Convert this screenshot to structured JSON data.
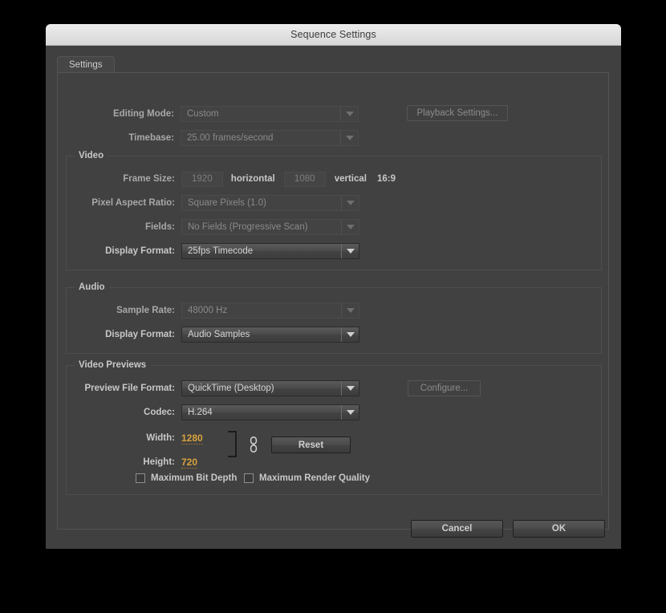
{
  "window": {
    "title": "Sequence Settings"
  },
  "tabs": [
    {
      "label": "Settings",
      "active": true
    }
  ],
  "top_rows": {
    "editing_mode": {
      "label": "Editing Mode:",
      "value": "Custom",
      "enabled": false
    },
    "timebase": {
      "label": "Timebase:",
      "value": "25.00 frames/second",
      "enabled": false
    },
    "playback_settings_button": {
      "label": "Playback Settings...",
      "enabled": false
    }
  },
  "video": {
    "group_title": "Video",
    "frame_size": {
      "label": "Frame Size:",
      "horizontal_value": "1920",
      "horizontal_label": "horizontal",
      "vertical_value": "1080",
      "vertical_label": "vertical",
      "aspect_ratio": "16:9",
      "enabled": false
    },
    "pixel_aspect_ratio": {
      "label": "Pixel Aspect Ratio:",
      "value": "Square Pixels (1.0)",
      "enabled": false
    },
    "fields": {
      "label": "Fields:",
      "value": "No Fields (Progressive Scan)",
      "enabled": false
    },
    "display_format": {
      "label": "Display Format:",
      "value": "25fps Timecode",
      "enabled": true
    }
  },
  "audio": {
    "group_title": "Audio",
    "sample_rate": {
      "label": "Sample Rate:",
      "value": "48000 Hz",
      "enabled": false
    },
    "display_format": {
      "label": "Display Format:",
      "value": "Audio Samples",
      "enabled": true
    }
  },
  "video_previews": {
    "group_title": "Video Previews",
    "preview_file_format": {
      "label": "Preview File Format:",
      "value": "QuickTime (Desktop)",
      "enabled": true
    },
    "configure_button": {
      "label": "Configure...",
      "enabled": false
    },
    "codec": {
      "label": "Codec:",
      "value": "H.264",
      "enabled": true
    },
    "width": {
      "label": "Width:",
      "value": "1280"
    },
    "height": {
      "label": "Height:",
      "value": "720"
    },
    "reset_button": {
      "label": "Reset"
    },
    "link_icon_name": "chain-link-icon",
    "checkboxes": [
      {
        "label": "Maximum Bit Depth",
        "checked": false
      },
      {
        "label": "Maximum Render Quality",
        "checked": false
      }
    ]
  },
  "footer": {
    "cancel_label": "Cancel",
    "ok_label": "OK"
  },
  "colors": {
    "accent_scrub": "#d8a23e",
    "dialog_bg": "#404040",
    "panel_bg": "#414141",
    "titlebar_bg": "#e3e3e3"
  }
}
